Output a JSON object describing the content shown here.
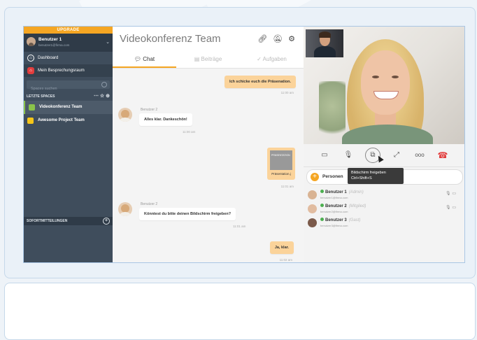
{
  "sidebar": {
    "upgrade_label": "UPGRADE",
    "user": {
      "name": "Benutzer 1",
      "email": "benutzer1@firma.com"
    },
    "nav": [
      {
        "label": "Dashboard",
        "icon": "home-icon"
      },
      {
        "label": "Mein Besprechungsraum",
        "icon": "room-icon"
      }
    ],
    "search_placeholder": "Spaces suchen",
    "recent_header": "LETZTE SPACES",
    "spaces": [
      {
        "label": "Videokonferenz Team",
        "color": "#8ac34a"
      },
      {
        "label": "Awesome Project Team",
        "color": "#f5c518"
      }
    ],
    "messages_header": "SOFORTMITTEILUNGEN"
  },
  "chat": {
    "title": "Videokonferenz Team",
    "tabs": [
      "Chat",
      "Beiträge",
      "Aufgaben"
    ],
    "messages": [
      {
        "text": "Ich schicke euch die Präsenation.",
        "time": "11:00 am"
      },
      {
        "sender": "Benutzer 2",
        "text": "Alles klar. Dankeschön!",
        "time": "11:00 am"
      },
      {
        "file_thumb": "PRÄSENTATION",
        "file_label": "Präsentation.j",
        "time": "11:01 am"
      },
      {
        "sender": "Benutzer 2",
        "text": "Könntest du bitte deinen Bildschirm freigeben?",
        "time": "11:01 am"
      },
      {
        "text": "Ja, klar.",
        "time": "11:02 am"
      }
    ]
  },
  "video": {
    "tooltip_line1": "Bildschirm freigeben",
    "tooltip_line2": "Ctrl+Shift+S",
    "persons_label": "Personen",
    "participants": [
      {
        "name": "Benutzer 1",
        "role": "(Admin)",
        "email": "benutzer1@firma.com"
      },
      {
        "name": "Benutzer 2",
        "role": "(Mitglied)",
        "email": "benutzer2@firma.com"
      },
      {
        "name": "Benutzer 3",
        "role": "(Gast)",
        "email": "benutzer3@firma.com"
      }
    ]
  }
}
